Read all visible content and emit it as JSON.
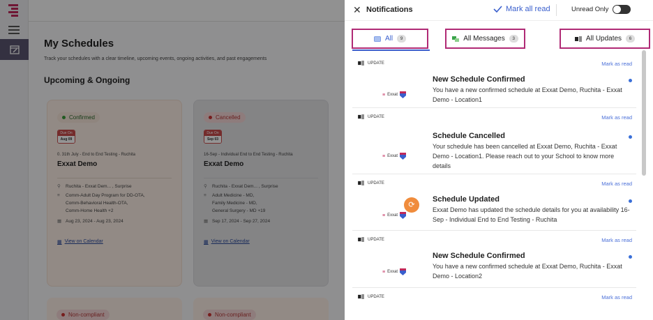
{
  "page": {
    "title": "My Schedules",
    "subtitle": "Track your schedules with a clear timeline, upcoming events, ongoing activities, and past engagements",
    "section": "Upcoming & Ongoing"
  },
  "cards": [
    {
      "status": "Confirmed",
      "due_label": "Due On",
      "due_date": "Aug 09",
      "subtitle": "0. 31th July - End to End Testing - Ruchita",
      "name": "Exxat Demo",
      "location": "Ruchita - Exxat Dem... , Surprise",
      "programs": [
        "Comm-Adult Day Program for DD-OTA,",
        "Comm-Behavioral Health-OTA,",
        "Comm-Home Health  +2"
      ],
      "dates": "Aug 23, 2024 - Aug 23, 2024",
      "link": "View on Calendar"
    },
    {
      "status": "Cancelled",
      "due_label": "Due On",
      "due_date": "Sep 03",
      "subtitle": "16-Sep - Individual End to End Testing - Ruchita",
      "name": "Exxat Demo",
      "location": "Ruchita - Exxat Dem... , Surprise",
      "programs": [
        "Adult Medicine - MD,",
        "Family Medicine - MD,",
        "General Surgery - MD  +19"
      ],
      "dates": "Sep 17, 2024 - Sep 27, 2024",
      "link": "View on Calendar"
    }
  ],
  "bottom_cards": [
    {
      "status": "Non-compliant"
    },
    {
      "status": "Non-compliant"
    }
  ],
  "panel": {
    "title": "Notifications",
    "mark_all": "Mark all read",
    "unread_only": "Unread Only",
    "unread_only_on": false,
    "tabs": [
      {
        "label": "All",
        "count": "9",
        "active": true
      },
      {
        "label": "All Messages",
        "count": "3",
        "active": false
      },
      {
        "label": "All Updates",
        "count": "6",
        "active": false
      }
    ],
    "items": [
      {
        "tag": "UPDATE",
        "mark_read": "Mark as read",
        "logo": "Exxat",
        "title": "New Schedule Confirmed",
        "body": "You have a new confirmed schedule at Exxat Demo, Ruchita - Exxat Demo - Location1"
      },
      {
        "tag": "UPDATE",
        "mark_read": "Mark as read",
        "logo": "Exxat",
        "title": "Schedule Cancelled",
        "body": "Your schedule has been cancelled at Exxat Demo, Ruchita - Exxat Demo - Location1. Please reach out to your School to know more details"
      },
      {
        "tag": "UPDATE",
        "mark_read": "Mark as read",
        "logo": "Exxat",
        "title": "Schedule Updated",
        "body": "Exxat Demo has updated the schedule details for you at availability 16-Sep - Individual End to End Testing - Ruchita"
      },
      {
        "tag": "UPDATE",
        "mark_read": "Mark as read",
        "logo": "Exxat",
        "title": "New Schedule Confirmed",
        "body": "You have a new confirmed schedule at Exxat Demo, Ruchita - Exxat Demo - Location2"
      },
      {
        "tag": "UPDATE",
        "mark_read": "Mark as read"
      }
    ]
  },
  "colors": {
    "accent": "#3a5fcd",
    "highlight_border": "#b02a75",
    "confirmed": "#3a9a3a",
    "cancelled": "#cc3333",
    "orange": "#f08c3c"
  }
}
